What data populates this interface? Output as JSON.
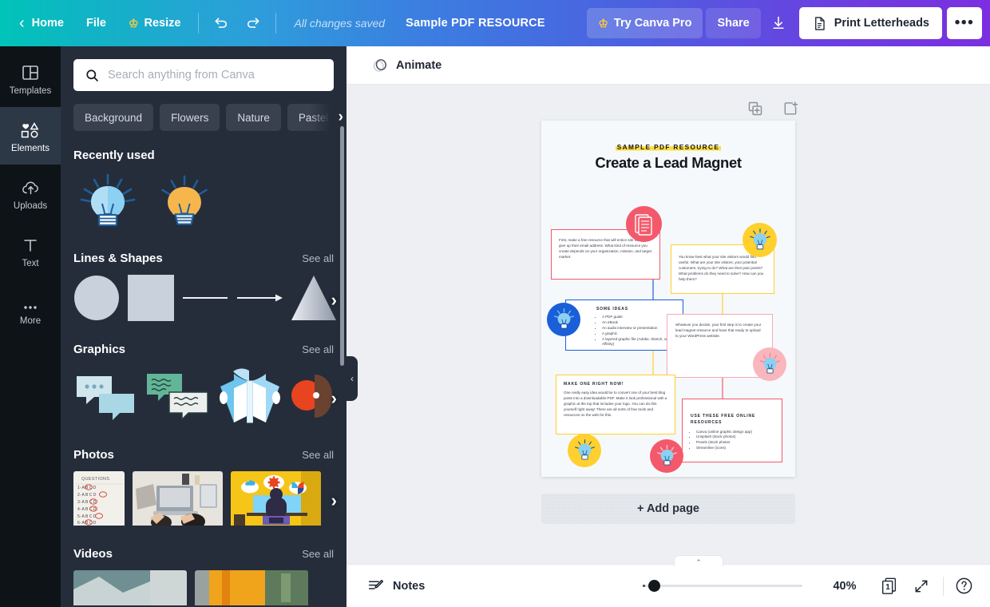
{
  "header": {
    "back_label": "Home",
    "file_label": "File",
    "resize_label": "Resize",
    "undo_icon": "undo-icon",
    "redo_icon": "redo-icon",
    "saved_status": "All changes saved",
    "design_title": "Sample PDF RESOURCE",
    "pro_label": "Try Canva Pro",
    "share_label": "Share",
    "download_icon": "download-icon",
    "print_label": "Print Letterheads",
    "more_label": "•••"
  },
  "rail": {
    "items": [
      {
        "label": "Templates",
        "icon": "templates-icon",
        "active": false
      },
      {
        "label": "Elements",
        "icon": "elements-icon",
        "active": true
      },
      {
        "label": "Uploads",
        "icon": "upload-cloud-icon",
        "active": false
      },
      {
        "label": "Text",
        "icon": "text-icon",
        "active": false
      },
      {
        "label": "More",
        "icon": "more-dots-icon",
        "active": false
      }
    ]
  },
  "panel": {
    "search_placeholder": "Search anything from Canva",
    "search_value": "",
    "chips": [
      "Background",
      "Flowers",
      "Nature",
      "Pastel"
    ],
    "chip_next": "›",
    "sections": [
      {
        "title": "Recently used",
        "see_all": ""
      },
      {
        "title": "Lines & Shapes",
        "see_all": "See all"
      },
      {
        "title": "Graphics",
        "see_all": "See all"
      },
      {
        "title": "Photos",
        "see_all": "See all"
      },
      {
        "title": "Videos",
        "see_all": "See all"
      }
    ],
    "collapse_icon": "chevron-left-icon"
  },
  "toolbar": {
    "animate_label": "Animate",
    "animate_icon": "animate-icon"
  },
  "canvas": {
    "duplicate_icon": "duplicate-page-icon",
    "addpage_icon": "add-page-icon",
    "add_page_label": "+ Add page"
  },
  "document": {
    "eyebrow": "SAMPLE PDF RESOURCE",
    "title": "Create a Lead Magnet",
    "cards": [
      {
        "id": "card-intro",
        "heading": "",
        "body": "First, make a free resource that will entice site visitors to give up their email address. What kind of resource you create depends on your organization, mission, and target market.",
        "border_color": "#f4596b"
      },
      {
        "id": "card-useful",
        "heading": "",
        "body": "You know best what your site visitors would find useful. What are your site visitors, your potential customers, trying to do? What are their pain points? What problems do they need to solve? How can you help them?",
        "border_color": "#ffd02e"
      },
      {
        "id": "card-some-ideas",
        "heading": "SOME IDEAS",
        "body": "",
        "bullets": [
          "A PDF guide",
          "An eBook",
          "An audio interview or presentation",
          "A graphic",
          "A layered graphic file (Adobe, Sketch, or Affinity)"
        ],
        "border_color": "#1a5fd8"
      },
      {
        "id": "card-whatever",
        "heading": "",
        "body": "Whatever you decide, your first step is to create your lead magnet resource and have that ready to upload to your WordPress website.",
        "border_color": "#f9a8b4"
      },
      {
        "id": "card-make-one",
        "heading": "MAKE ONE RIGHT NOW!",
        "body": "One really easy idea would be to convert one of your best blog posts into a downloadable PDF. Make it look professional with a graphic at the top that includes your logo. You can do this yourself right away! There are all sorts of free tools and resources on the web for this.",
        "border_color": "#ffd02e"
      },
      {
        "id": "card-resources",
        "heading": "USE THESE FREE ONLINE RESOURCES",
        "body": "",
        "bullets": [
          "Canva (online graphic design app)",
          "Unsplash (stock photos)",
          "Pexels (stock photos",
          "Streamline (icons)"
        ],
        "border_color": "#f4596b"
      }
    ],
    "badges": [
      {
        "id": "badge-doc",
        "icon": "document-stack-icon",
        "color": "#f4596b"
      },
      {
        "id": "badge-bulb-yellow",
        "icon": "lightbulb-icon",
        "color": "#ffd02e"
      },
      {
        "id": "badge-bulb-blue",
        "icon": "lightbulb-icon",
        "color": "#1a5fd8"
      },
      {
        "id": "badge-bulb-pink",
        "icon": "lightbulb-icon",
        "color": "#f9b6bd"
      },
      {
        "id": "badge-bulb-yellow2",
        "icon": "lightbulb-icon",
        "color": "#ffd02e"
      },
      {
        "id": "badge-bulb-red",
        "icon": "lightbulb-icon",
        "color": "#f4596b"
      }
    ]
  },
  "bottombar": {
    "notes_label": "Notes",
    "notes_icon": "notes-icon",
    "zoom_value": "40%",
    "zoom_percent": 40,
    "page_number": "1",
    "pages_icon": "pages-icon",
    "expand_icon": "expand-icon",
    "help_icon": "help-icon",
    "notes_tab_icon": "chevron-up-icon"
  },
  "colors": {
    "header_start": "#00c4b8",
    "header_end": "#7b2fe0",
    "panel_bg": "#252d3b",
    "rail_bg": "#0e1318",
    "accent_yellow": "#ffde3d",
    "accent_red": "#f4596b",
    "accent_blue": "#1a5fd8"
  }
}
